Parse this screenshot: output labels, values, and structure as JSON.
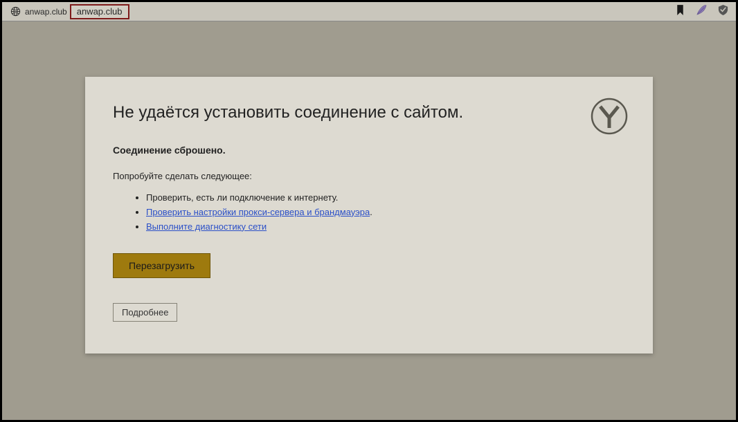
{
  "browser": {
    "tab_label": "anwap.club",
    "url": "anwap.club"
  },
  "error": {
    "title": "Не удаётся установить соединение с сайтом.",
    "subtitle": "Соединение сброшено.",
    "prompt": "Попробуйте сделать следующее:",
    "suggestions": {
      "item1_text": "Проверить, есть ли подключение к интернету.",
      "item2_link": "Проверить настройки прокси-сервера и брандмауэра",
      "item3_link": "Выполните диагностику сети"
    },
    "reload_label": "Перезагрузить",
    "details_label": "Подробнее"
  }
}
